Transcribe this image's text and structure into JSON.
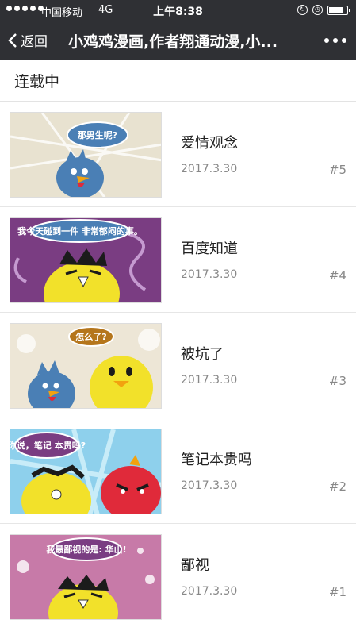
{
  "status_bar": {
    "carrier": "中国移动",
    "network": "4G",
    "time": "上午8:38",
    "battery_level": 0.92
  },
  "nav": {
    "back_label": "返回",
    "title": "小鸡鸡漫画,作者翔通动漫,小..."
  },
  "section": {
    "title": "连载中"
  },
  "episodes": [
    {
      "title": "爱情观念",
      "date": "2017.3.30",
      "number": "#5",
      "bubble": "那男生呢?"
    },
    {
      "title": "百度知道",
      "date": "2017.3.30",
      "number": "#4",
      "bubble": "我今天碰到一件 非常郁闷的事。"
    },
    {
      "title": "被坑了",
      "date": "2017.3.30",
      "number": "#3",
      "bubble": "怎么了?"
    },
    {
      "title": "笔记本贵吗",
      "date": "2017.3.30",
      "number": "#2",
      "bubble": "你说，笔记 本贵吗?"
    },
    {
      "title": "鄙视",
      "date": "2017.3.30",
      "number": "#1",
      "bubble": "我最鄙视的是: 华山!"
    }
  ],
  "colors": {
    "topbar": "#2f3034",
    "chick_yellow": "#f2e12a",
    "chick_blue": "#4a7fb5",
    "chick_red": "#e02a3a"
  }
}
